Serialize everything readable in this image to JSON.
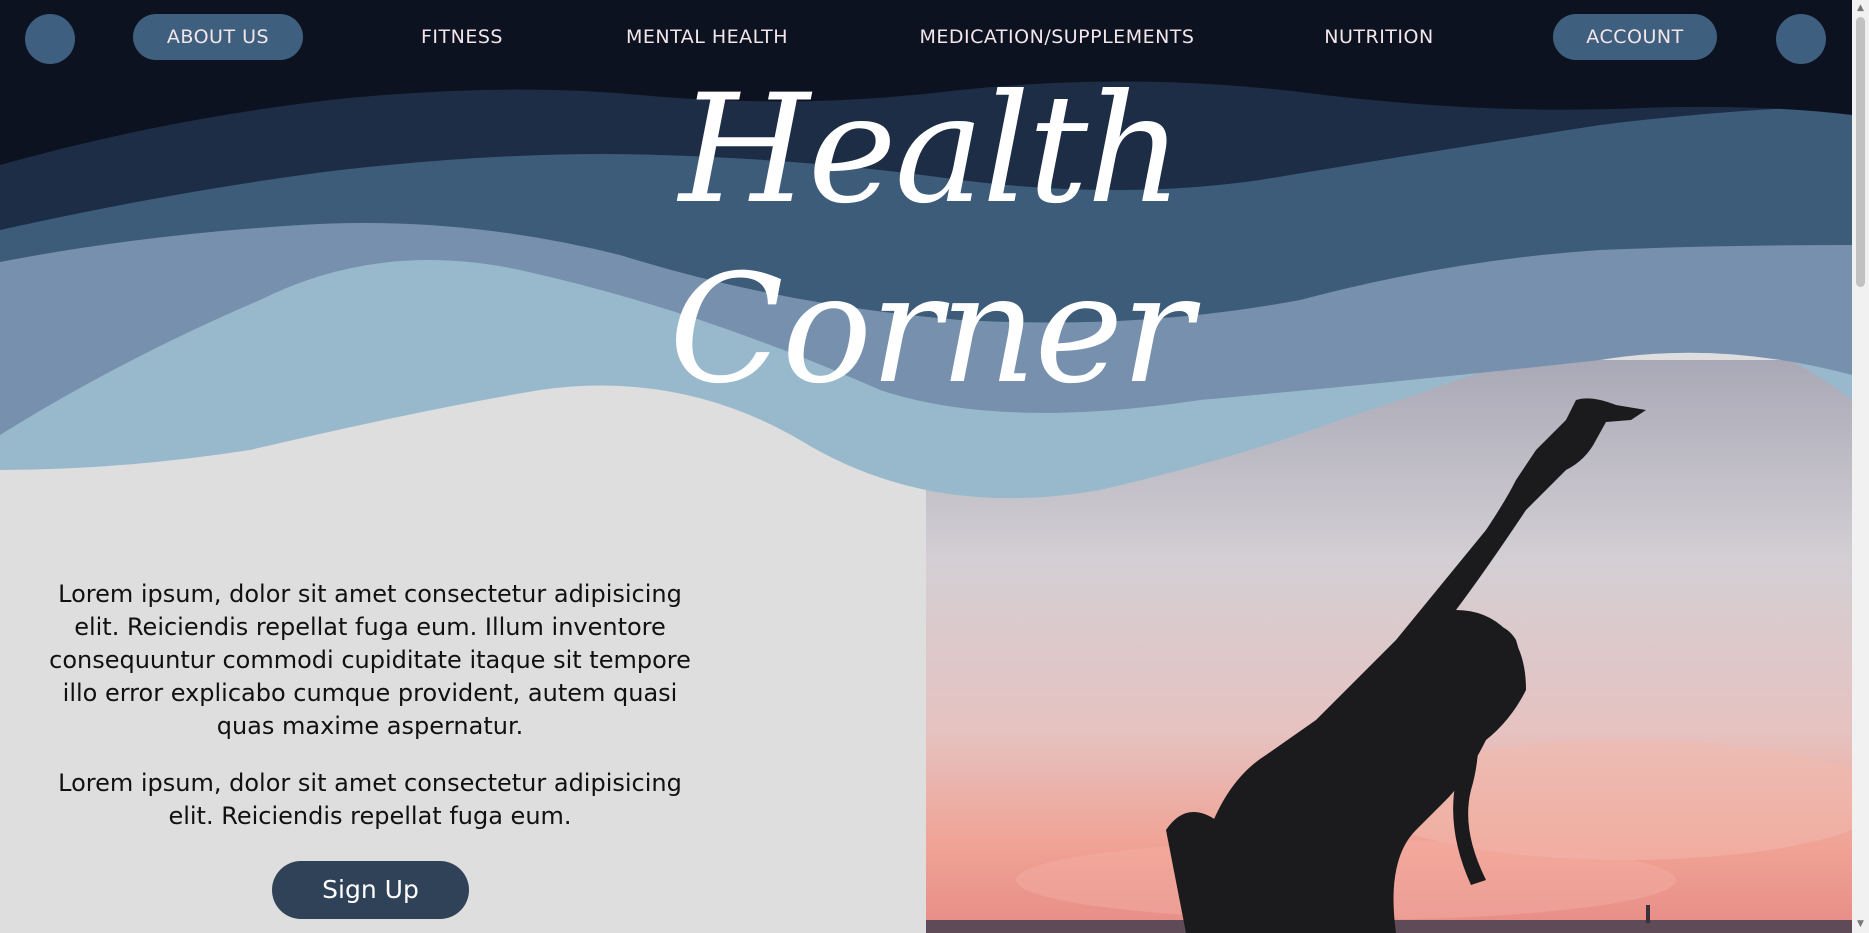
{
  "nav": {
    "items": [
      {
        "label": "ABOUT US"
      },
      {
        "label": "FITNESS"
      },
      {
        "label": "MENTAL HEALTH"
      },
      {
        "label": "MEDICATION/SUPPLEMENTS"
      },
      {
        "label": "NUTRITION"
      },
      {
        "label": "ACCOUNT"
      }
    ]
  },
  "hero": {
    "title": "Health Corner"
  },
  "content": {
    "paragraph1": "Lorem ipsum, dolor sit amet consectetur adipisicing elit. Reiciendis repellat fuga eum. Illum inventore consequuntur commodi cupiditate itaque sit tempore illo error explicabo cumque provident, autem quasi quas maxime aspernatur.",
    "paragraph2": "Lorem ipsum, dolor sit amet consectetur adipisicing elit. Reiciendis repellat fuga eum.",
    "signup_label": "Sign Up"
  },
  "colors": {
    "navy_dark": "#0d1220",
    "wave_1": "#1c2d45",
    "wave_2": "#3d5c7a",
    "wave_3": "#7690ae",
    "wave_4": "#98b9cc",
    "page_bg": "#dedede",
    "pill": "#3f5f7e",
    "button": "#2f4257"
  },
  "icons": {
    "left_circle": "logo-circle-icon",
    "right_circle": "profile-circle-icon"
  }
}
